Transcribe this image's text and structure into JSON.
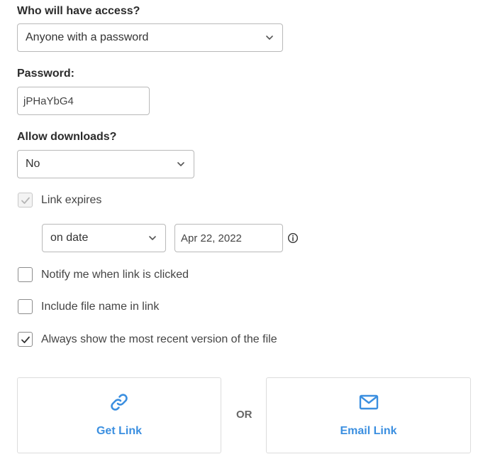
{
  "access": {
    "label": "Who will have access?",
    "selected": "Anyone with a password"
  },
  "password": {
    "label": "Password:",
    "value": "jPHaYbG4"
  },
  "downloads": {
    "label": "Allow downloads?",
    "selected": "No"
  },
  "link_expires": {
    "label": "Link expires",
    "checked": true,
    "disabled": true,
    "mode_selected": "on date",
    "date_value": "Apr 22, 2022"
  },
  "options": [
    {
      "label": "Notify me when link is clicked",
      "checked": false
    },
    {
      "label": "Include file name in link",
      "checked": false
    },
    {
      "label": "Always show the most recent version of the file",
      "checked": true
    }
  ],
  "actions": {
    "get_link_label": "Get Link",
    "or_label": "OR",
    "email_link_label": "Email Link"
  },
  "colors": {
    "accent": "#3b8fe0",
    "border": "#b9b9b9"
  },
  "icons": {
    "get_link": "link-icon",
    "email_link": "mail-icon",
    "date_info": "info-icon",
    "dropdown": "chevron-down-icon"
  }
}
